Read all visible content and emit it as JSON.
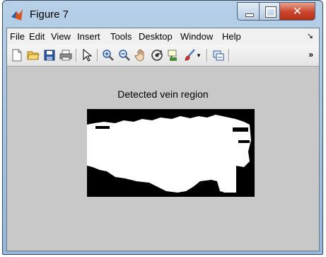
{
  "window": {
    "title": "Figure 7"
  },
  "menu": {
    "items": [
      "File",
      "Edit",
      "View",
      "Insert",
      "Tools",
      "Desktop",
      "Window",
      "Help"
    ]
  },
  "toolbar": {
    "icons": [
      "new-figure-icon",
      "open-file-icon",
      "save-icon",
      "print-icon",
      "edit-plot-icon",
      "zoom-in-icon",
      "zoom-out-icon",
      "pan-icon",
      "rotate-3d-icon",
      "data-cursor-icon",
      "brush-icon",
      "link-plot-icon"
    ]
  },
  "figure": {
    "title": "Detected vein region"
  },
  "colors": {
    "figure_bg": "#c8c8c8",
    "title_bar": "#b7d0e8",
    "close_button": "#c9432a",
    "image_fg": "#ffffff",
    "image_bg": "#000000"
  }
}
